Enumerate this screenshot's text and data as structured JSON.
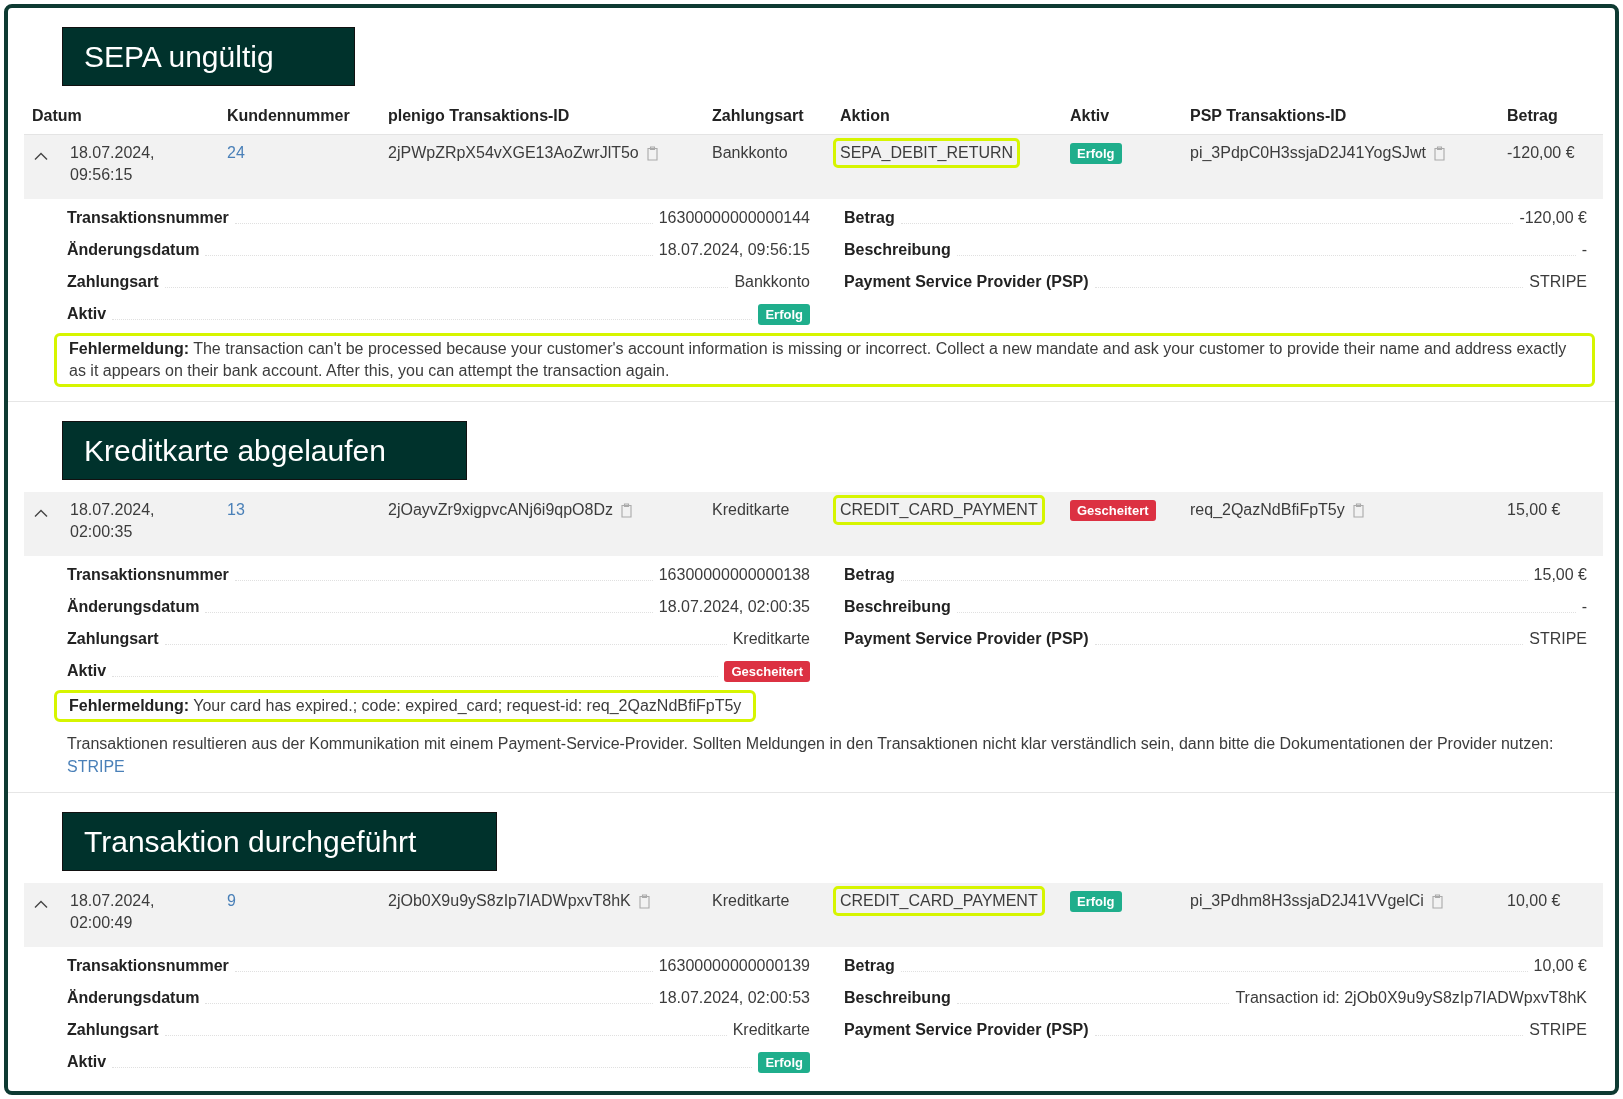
{
  "sections": [
    {
      "title": "SEPA ungültig",
      "columns": [
        "Datum",
        "Kundennummer",
        "plenigo Transaktions-ID",
        "Zahlungsart",
        "Aktion",
        "Aktiv",
        "PSP Transaktions-ID",
        "Betrag"
      ],
      "transaction": {
        "expanded": true,
        "date": "18.07.2024, 09:56:15",
        "customer": "24",
        "plenigo_id": "2jPWpZRpX54vXGE13AoZwrJlT5o",
        "payment_method": "Bankkonto",
        "action": {
          "text": "SEPA_DEBIT_RETURN",
          "highlighted": true
        },
        "status": {
          "text": "Erfolg",
          "kind": "success"
        },
        "psp_id": "pi_3PdpC0H3ssjaD2J41YogSJwt",
        "amount": "-120,00 €"
      },
      "details_left": [
        {
          "label": "Transaktionsnummer",
          "value": "16300000000000144"
        },
        {
          "label": "Änderungsdatum",
          "value": "18.07.2024, 09:56:15"
        },
        {
          "label": "Zahlungsart",
          "value": "Bankkonto"
        },
        {
          "label": "Aktiv",
          "status": {
            "text": "Erfolg",
            "kind": "success"
          }
        }
      ],
      "details_right": [
        {
          "label": "Betrag",
          "value": "-120,00 €"
        },
        {
          "label": "Beschreibung",
          "value": "-"
        },
        {
          "label": "Payment Service Provider (PSP)",
          "value": "STRIPE"
        }
      ],
      "error": {
        "text": "**Fehlermeldung:** The transaction can't be processed because your customer's account information is missing or incorrect. Collect a new mandate and ask your customer to provide their name and address exactly as it appears on their bank account. After this, you can attempt the transaction again.",
        "highlighted": true
      }
    },
    {
      "title": "Kreditkarte abgelaufen",
      "transaction": {
        "expanded": true,
        "date": "18.07.2024, 02:00:35",
        "customer": "13",
        "plenigo_id": "2jOayvZr9xigpvcANj6i9qpO8Dz",
        "payment_method": "Kreditkarte",
        "action": {
          "text": "CREDIT_CARD_PAYMENT",
          "highlighted": true
        },
        "status": {
          "text": "Gescheitert",
          "kind": "failure"
        },
        "psp_id": "req_2QazNdBfiFpT5y",
        "amount": "15,00 €"
      },
      "details_left": [
        {
          "label": "Transaktionsnummer",
          "value": "16300000000000138"
        },
        {
          "label": "Änderungsdatum",
          "value": "18.07.2024, 02:00:35"
        },
        {
          "label": "Zahlungsart",
          "value": "Kreditkarte"
        },
        {
          "label": "Aktiv",
          "status": {
            "text": "Gescheitert",
            "kind": "failure"
          }
        }
      ],
      "details_right": [
        {
          "label": "Betrag",
          "value": "15,00 €"
        },
        {
          "label": "Beschreibung",
          "value": "-"
        },
        {
          "label": "Payment Service Provider (PSP)",
          "value": "STRIPE"
        }
      ],
      "error": {
        "text": "**Fehlermeldung:** Your card has expired.; code: expired_card; request-id: req_2QazNdBfiFpT5y",
        "highlighted": true
      },
      "note": {
        "text": "Transaktionen resultieren aus der Kommunikation mit einem Payment-Service-Provider. Sollten Meldungen in den Transaktionen nicht klar verständlich sein, dann bitte die Dokumentationen der Provider nutzen:",
        "link": "STRIPE"
      }
    },
    {
      "title": "Transaktion durchgeführt",
      "transaction": {
        "expanded": true,
        "date": "18.07.2024, 02:00:49",
        "customer": "9",
        "plenigo_id": "2jOb0X9u9yS8zIp7IADWpxvT8hK",
        "payment_method": "Kreditkarte",
        "action": {
          "text": "CREDIT_CARD_PAYMENT",
          "highlighted": true
        },
        "status": {
          "text": "Erfolg",
          "kind": "success"
        },
        "psp_id": "pi_3Pdhm8H3ssjaD2J41VVgelCi",
        "amount": "10,00 €"
      },
      "details_left": [
        {
          "label": "Transaktionsnummer",
          "value": "16300000000000139"
        },
        {
          "label": "Änderungsdatum",
          "value": "18.07.2024, 02:00:53"
        },
        {
          "label": "Zahlungsart",
          "value": "Kreditkarte"
        },
        {
          "label": "Aktiv",
          "status": {
            "text": "Erfolg",
            "kind": "success"
          }
        }
      ],
      "details_right": [
        {
          "label": "Betrag",
          "value": "10,00 €"
        },
        {
          "label": "Beschreibung",
          "value": "Transaction id: 2jOb0X9u9yS8zIp7IADWpxvT8hK"
        },
        {
          "label": "Payment Service Provider (PSP)",
          "value": "STRIPE"
        }
      ]
    }
  ]
}
